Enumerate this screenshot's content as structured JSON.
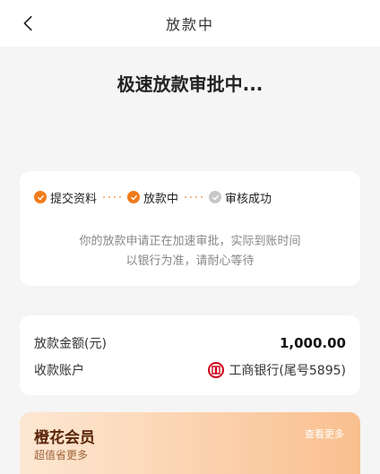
{
  "nav": {
    "title": "放款中"
  },
  "headline": "极速放款审批中...",
  "progress": {
    "steps": [
      {
        "label": "提交资料",
        "state": "done"
      },
      {
        "label": "放款中",
        "state": "done"
      },
      {
        "label": "审核成功",
        "state": "pending"
      }
    ],
    "desc_line1": "你的放款申请正在加速审批，实际到账时间",
    "desc_line2": "以银行为准，请耐心等待"
  },
  "info": {
    "amount_label": "放款金额(元)",
    "amount_value": "1,000.00",
    "account_label": "收款账户",
    "account_value": "工商银行(尾号5895)"
  },
  "member": {
    "title": "橙花会员",
    "subtitle": "超值省更多",
    "more": "查看更多"
  },
  "colors": {
    "accent": "#f27a1a",
    "pending": "#c8c8c8",
    "bank_red": "#d0021b"
  },
  "icons": {
    "back": "chevron-left-icon",
    "done": "check-circle-icon",
    "pending": "check-circle-gray-icon",
    "bank": "icbc-logo-icon"
  }
}
